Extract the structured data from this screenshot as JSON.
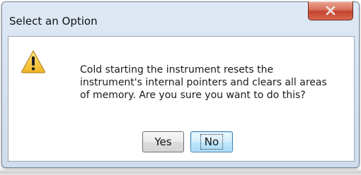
{
  "window": {
    "title": "Select an Option",
    "close_icon": "close-x-icon"
  },
  "message": {
    "icon": "warning-icon",
    "lines": [
      "Cold starting the instrument resets the",
      "instrument's internal pointers and clears all areas",
      "of memory. Are you sure you want to do this?"
    ]
  },
  "buttons": {
    "yes_label": "Yes",
    "no_label": "No",
    "focused": "No"
  },
  "colors": {
    "close_button": "#c94a34",
    "warning_fill": "#f6c93b",
    "focused_button_border": "#3c7fb1"
  }
}
